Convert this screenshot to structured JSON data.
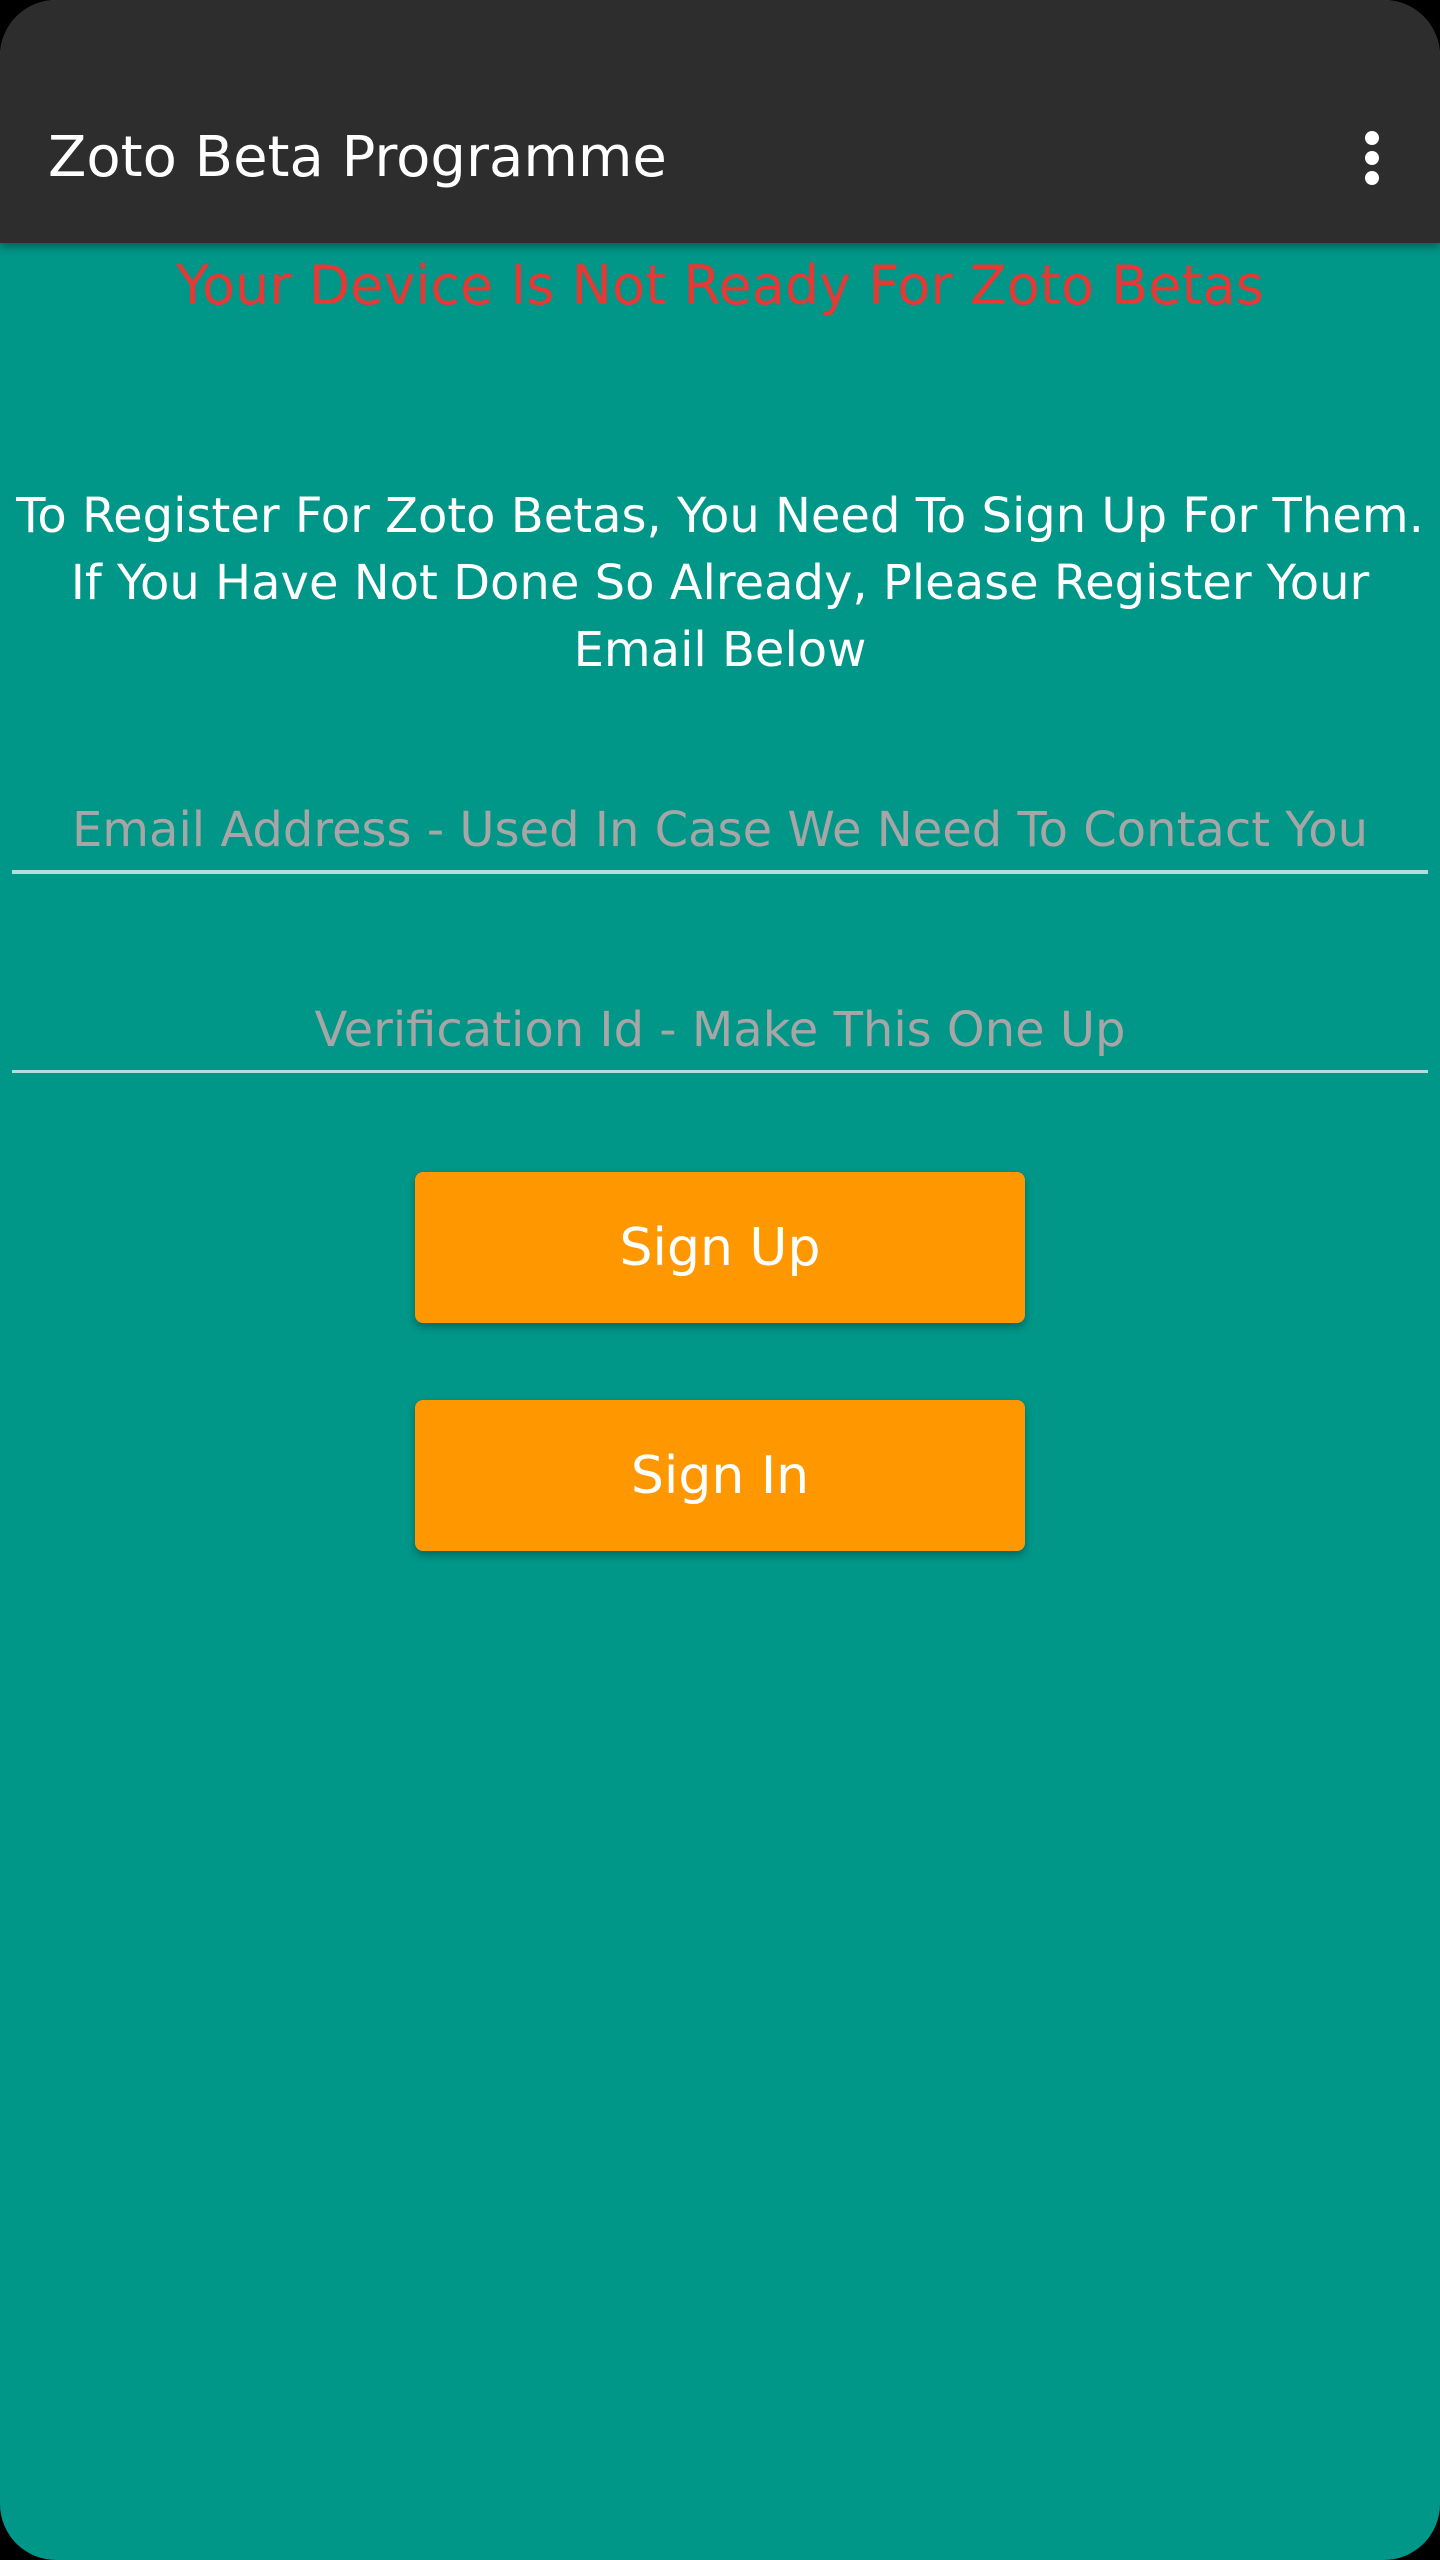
{
  "app_bar": {
    "title": "Zoto Beta Programme",
    "menu_icon": "more-vert-icon"
  },
  "status": {
    "message": "Your Device Is Not Ready For Zoto Betas",
    "color": "#e53935"
  },
  "instructions": {
    "text": "To Register For Zoto Betas, You Need To Sign Up For Them. If You Have Not Done So Already, Please Register Your Email Below"
  },
  "form": {
    "email": {
      "placeholder": "Email Address - Used In Case We Need To Contact You",
      "value": ""
    },
    "verification": {
      "placeholder": "Verification Id - Make This One Up",
      "value": ""
    },
    "sign_up_label": "Sign Up",
    "sign_in_label": "Sign In"
  },
  "colors": {
    "background": "#009688",
    "app_bar": "#2d2d2d",
    "button": "#ff9800"
  }
}
